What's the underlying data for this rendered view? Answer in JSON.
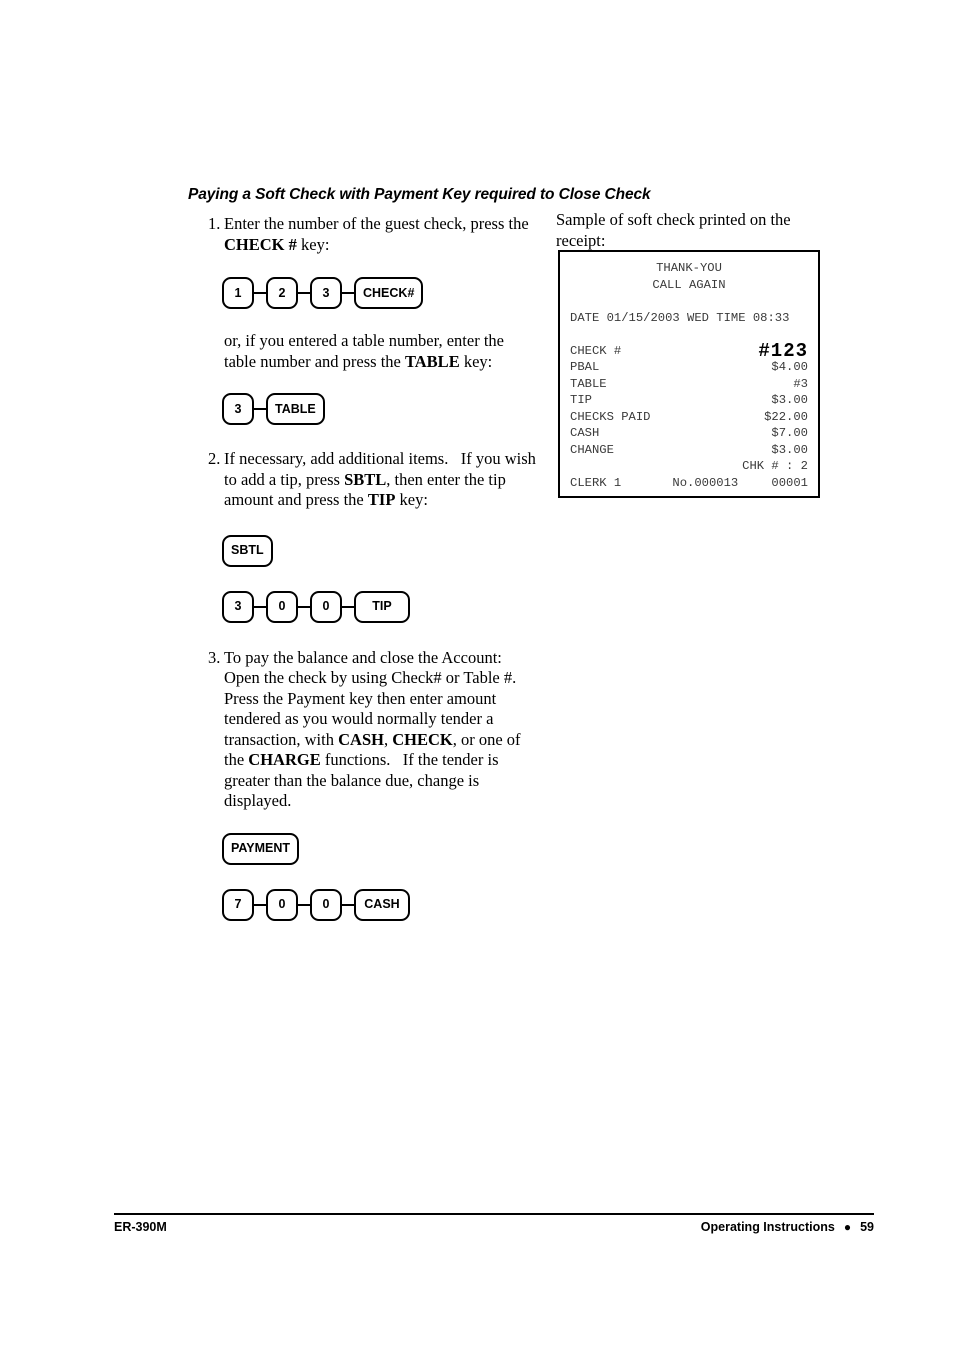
{
  "section": {
    "title": "Paying a Soft Check with Payment Key required to Close Check"
  },
  "steps": [
    {
      "number": "1.",
      "text_html": "Enter the number of the guest check, press the <b>CHECK #</b> key:"
    },
    {
      "number": "2.",
      "text_html": "If necessary, add additional items.&nbsp;&nbsp; If you wish to add a tip, press <b>SBTL</b>, then enter the tip amount and press the <b>TIP</b> key:"
    },
    {
      "number": "3.",
      "text_html": "To pay the balance and close the Account:&nbsp;&nbsp; Open the check by using Check# or Table #.&nbsp;&nbsp; Press the Payment key then enter amount tendered as you would normally tender a transaction, with <b>CASH</b>, <b>CHECK</b>, or one of the <b>CHARGE</b> functions.&nbsp;&nbsp; If the tender is greater than the balance due, change is displayed."
    }
  ],
  "alt_paragraph": {
    "text_html": "or, if you entered a table number, enter the table number and press the <b>TABLE</b> key:"
  },
  "key_sequences": {
    "check_number": [
      "1",
      "2",
      "3",
      "CHECK#"
    ],
    "table_number": [
      "3",
      "TABLE"
    ],
    "subtotal": [
      "SBTL"
    ],
    "tip_amount": [
      "3",
      "0",
      "0",
      "TIP"
    ],
    "payment": [
      "PAYMENT"
    ],
    "cash_tender": [
      "7",
      "0",
      "0",
      "CASH"
    ]
  },
  "receipt": {
    "caption": "Sample of soft check printed on the receipt:",
    "header_lines": [
      "THANK-YOU",
      "CALL AGAIN"
    ],
    "datetime": {
      "date_label": "DATE",
      "date_value": "01/15/2003",
      "weekday": "WED",
      "time_label": "TIME",
      "time_value": "08:33",
      "full_line": "DATE 01/15/2003 WED   TIME 08:33"
    },
    "check_number_label": "CHECK #",
    "check_number_value": "#123",
    "rows": [
      {
        "label": "PBAL",
        "value": "$4.00"
      },
      {
        "label": "TABLE",
        "value": "#3"
      },
      {
        "label": "TIP",
        "value": "$3.00"
      },
      {
        "label": "CHECKS PAID",
        "value": "$22.00"
      },
      {
        "label": "CASH",
        "value": "$7.00"
      },
      {
        "label": "CHANGE",
        "value": "$3.00"
      }
    ],
    "chk_line": "CHK # : 2",
    "footer": {
      "clerk": "CLERK 1",
      "consecutive_no": "No.000013",
      "register_no": "00001"
    }
  },
  "page_footer": {
    "model": "ER-390M",
    "section_label": "Operating Instructions",
    "bullet": "●",
    "page_number": "59"
  }
}
